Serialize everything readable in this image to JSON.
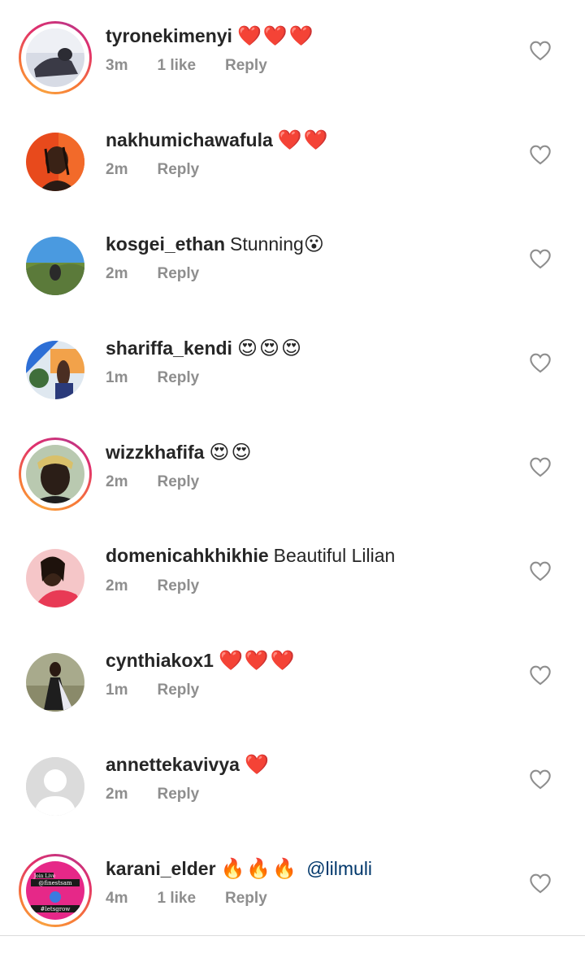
{
  "comments": [
    {
      "username": "tyronekimenyi",
      "text": "",
      "emoji": "❤️❤️❤️",
      "emoji_type": "heart",
      "mention": "",
      "time": "3m",
      "likes": "1 like",
      "reply": "Reply",
      "story_ring": true,
      "avatar_colors": [
        "#cfd3de",
        "#3a3a46"
      ]
    },
    {
      "username": "nakhumichawafula",
      "text": "",
      "emoji": "❤️❤️",
      "emoji_type": "heart",
      "mention": "",
      "time": "2m",
      "likes": "",
      "reply": "Reply",
      "story_ring": false,
      "avatar_colors": [
        "#e84a1c",
        "#2a1a14"
      ]
    },
    {
      "username": "kosgei_ethan",
      "text": "Stunning",
      "emoji": "😮",
      "emoji_type": "face",
      "mention": "",
      "time": "2m",
      "likes": "",
      "reply": "Reply",
      "story_ring": false,
      "avatar_colors": [
        "#4a9ae0",
        "#5b7a3a"
      ]
    },
    {
      "username": "shariffa_kendi",
      "text": "",
      "emoji": "😍😍😍",
      "emoji_type": "face",
      "mention": "",
      "time": "1m",
      "likes": "",
      "reply": "Reply",
      "story_ring": false,
      "avatar_colors": [
        "#f2a24a",
        "#3f6e3a"
      ]
    },
    {
      "username": "wizzkhafifa",
      "text": "",
      "emoji": "😍😍",
      "emoji_type": "face",
      "mention": "",
      "time": "2m",
      "likes": "",
      "reply": "Reply",
      "story_ring": true,
      "avatar_colors": [
        "#b9c9b0",
        "#2b1e17"
      ]
    },
    {
      "username": "domenicahkhikhie",
      "text": "Beautiful Lilian",
      "emoji": "",
      "emoji_type": "none",
      "mention": "",
      "time": "2m",
      "likes": "",
      "reply": "Reply",
      "story_ring": false,
      "avatar_colors": [
        "#f5c6c8",
        "#e83a55"
      ]
    },
    {
      "username": "cynthiakox1",
      "text": "",
      "emoji": "❤️❤️❤️",
      "emoji_type": "heart",
      "mention": "",
      "time": "1m",
      "likes": "",
      "reply": "Reply",
      "story_ring": false,
      "avatar_colors": [
        "#a8aa8c",
        "#1e1e1e"
      ]
    },
    {
      "username": "annettekavivya",
      "text": "",
      "emoji": "❤️",
      "emoji_type": "heart",
      "mention": "",
      "time": "2m",
      "likes": "",
      "reply": "Reply",
      "story_ring": false,
      "avatar_colors": [
        "#dbdbdb",
        "#ffffff"
      ]
    },
    {
      "username": "karani_elder",
      "text": "",
      "emoji": "🔥🔥🔥",
      "emoji_type": "fire",
      "mention": "@lilmuli",
      "time": "4m",
      "likes": "1 like",
      "reply": "Reply",
      "story_ring": true,
      "avatar_colors": [
        "#e62888",
        "#ffffff"
      ],
      "avatar_text": [
        "Join Live",
        "@finestsam",
        "#letsgrow"
      ]
    }
  ],
  "icons": {
    "like": "heart-outline-icon"
  },
  "colors": {
    "username": "#262626",
    "meta": "#8e8e8e",
    "mention": "#00376b",
    "heart": "#ed1c3b"
  }
}
